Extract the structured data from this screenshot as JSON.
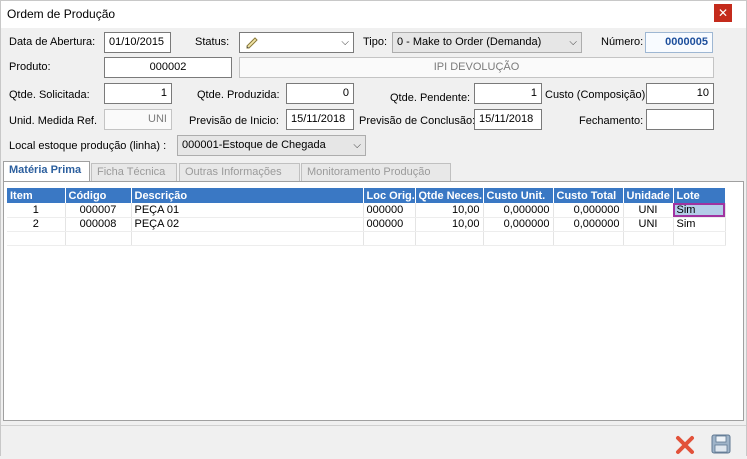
{
  "window": {
    "title": "Ordem de Produção",
    "close_glyph": "✕"
  },
  "form": {
    "data_abertura_label": "Data de Abertura:",
    "data_abertura_value": "01/10/2015",
    "status_label": "Status:",
    "tipo_label": "Tipo:",
    "tipo_value": "0 - Make to Order (Demanda)",
    "numero_label": "Número:",
    "numero_value": "0000005",
    "produto_label": "Produto:",
    "produto_code": "000002",
    "produto_desc": "IPI DEVOLUÇÃO",
    "qtde_solicitada_label": "Qtde. Solicitada:",
    "qtde_solicitada_value": "1",
    "qtde_produzida_label": "Qtde. Produzida:",
    "qtde_produzida_value": "0",
    "qtde_pendente_label": "Qtde. Pendente:",
    "qtde_pendente_value": "1",
    "custo_label": "Custo (Composição):",
    "custo_value": "10",
    "unid_label": "Unid. Medida Ref.",
    "unid_value": "UNI",
    "previsao_inicio_label": "Previsão de Inicio:",
    "previsao_inicio_value": "15/11/2018",
    "previsao_conclusao_label": "Previsão de Conclusão:",
    "previsao_conclusao_value": "15/11/2018",
    "fechamento_label": "Fechamento:",
    "fechamento_value": "",
    "local_label": "Local estoque produção (linha) :",
    "local_value": "000001-Estoque de Chegada"
  },
  "tabs": [
    "Matéria Prima",
    "Ficha Técnica",
    "Outras Informações",
    "Monitoramento Produção"
  ],
  "grid": {
    "columns": [
      "Item",
      "Código",
      "Descrição",
      "Loc Orig.",
      "Qtde Neces.",
      "Custo Unit.",
      "Custo Total",
      "Unidade",
      "Lote"
    ],
    "rows": [
      [
        "1",
        "000007",
        "PEÇA 01",
        "000000",
        "10,00",
        "0,000000",
        "0,000000",
        "UNI",
        "Sim"
      ],
      [
        "2",
        "000008",
        "PEÇA 02",
        "000000",
        "10,00",
        "0,000000",
        "0,000000",
        "UNI",
        "Sim"
      ]
    ]
  },
  "icons": {
    "status": "pencil-icon",
    "cancel": "cancel-x-icon",
    "save": "floppy-disk-icon"
  },
  "colors": {
    "header_bg": "#3a78c4",
    "selection_outline": "#a033a0",
    "cancel": "#e2523a",
    "active_tab": "#2c5f9e"
  }
}
